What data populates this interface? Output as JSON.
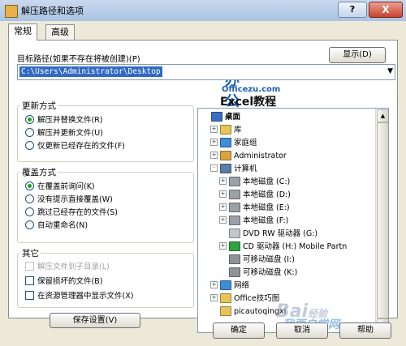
{
  "window": {
    "title": "解压路径和选项",
    "help_label": "?",
    "close_label": "X"
  },
  "tabs": [
    {
      "label": "常规"
    },
    {
      "label": "高级"
    }
  ],
  "logo": {
    "main": "办公族",
    "sub": "Officezu.com",
    "subtitle": "Excel教程"
  },
  "target": {
    "label": "目标路径(如果不存在将被创建)(P)",
    "value": "C:\\Users\\Administrator\\Desktop",
    "show_button": "显示(D)"
  },
  "update_mode": {
    "title": "更新方式",
    "options": [
      {
        "label": "解压并替换文件(R)",
        "selected": true
      },
      {
        "label": "解压并更新文件(U)",
        "selected": false
      },
      {
        "label": "仅更新已经存在的文件(F)",
        "selected": false
      }
    ]
  },
  "overwrite_mode": {
    "title": "覆盖方式",
    "options": [
      {
        "label": "在覆盖前询问(K)",
        "selected": true
      },
      {
        "label": "没有提示直接覆盖(W)",
        "selected": false
      },
      {
        "label": "跳过已经存在的文件(S)",
        "selected": false
      },
      {
        "label": "自动重命名(N)",
        "selected": false
      }
    ]
  },
  "misc": {
    "title": "其它",
    "options": [
      {
        "label": "解压文件到子目录(L)",
        "checked": false,
        "disabled": true
      },
      {
        "label": "保留损坏的文件(B)",
        "checked": false,
        "disabled": false
      },
      {
        "label": "在资源管理器中显示文件(X)",
        "checked": false,
        "disabled": false
      }
    ]
  },
  "save_button": "保存设置(V)",
  "tree": {
    "items": [
      {
        "label": "桌面",
        "level": 0,
        "expander": "",
        "icon": "desktop-icon",
        "color": "#3a6fc4",
        "bold": true
      },
      {
        "label": "库",
        "level": 1,
        "expander": "+",
        "icon": "folder-icon",
        "color": "#e7c45a"
      },
      {
        "label": "家庭组",
        "level": 1,
        "expander": "+",
        "icon": "homegroup-icon",
        "color": "#3d8ed8"
      },
      {
        "label": "Administrator",
        "level": 1,
        "expander": "+",
        "icon": "user-icon",
        "color": "#d8a53d"
      },
      {
        "label": "计算机",
        "level": 1,
        "expander": "-",
        "icon": "computer-icon",
        "color": "#5a7fa8"
      },
      {
        "label": "本地磁盘 (C:)",
        "level": 2,
        "expander": "+",
        "icon": "drive-icon",
        "color": "#9aa2a8"
      },
      {
        "label": "本地磁盘 (D:)",
        "level": 2,
        "expander": "+",
        "icon": "drive-icon",
        "color": "#9aa2a8"
      },
      {
        "label": "本地磁盘 (E:)",
        "level": 2,
        "expander": "+",
        "icon": "drive-icon",
        "color": "#9aa2a8"
      },
      {
        "label": "本地磁盘 (F:)",
        "level": 2,
        "expander": "+",
        "icon": "drive-icon",
        "color": "#9aa2a8"
      },
      {
        "label": "DVD RW 驱动器 (G:)",
        "level": 2,
        "expander": "",
        "icon": "dvd-icon",
        "color": "#c2c6ca"
      },
      {
        "label": "CD 驱动器 (H:) Mobile Partn",
        "level": 2,
        "expander": "+",
        "icon": "cd-icon",
        "color": "#2ea33f"
      },
      {
        "label": "可移动磁盘 (I:)",
        "level": 2,
        "expander": "",
        "icon": "removable-drive-icon",
        "color": "#8e9499"
      },
      {
        "label": "可移动磁盘 (K:)",
        "level": 2,
        "expander": "",
        "icon": "removable-drive-icon",
        "color": "#8e9499"
      },
      {
        "label": "网络",
        "level": 1,
        "expander": "+",
        "icon": "network-icon",
        "color": "#3d8ed8"
      },
      {
        "label": "Office技巧图",
        "level": 1,
        "expander": "+",
        "icon": "folder-icon",
        "color": "#e7c45a"
      },
      {
        "label": "picautoqingxi",
        "level": 1,
        "expander": "",
        "icon": "folder-icon",
        "color": "#e7c45a"
      }
    ]
  },
  "watermark": {
    "text": "Bai",
    "sub": "经验",
    "caption": "我要自学网"
  },
  "footer": {
    "ok": "确定",
    "cancel": "取消",
    "help": "帮助"
  },
  "colors": {
    "selection": "#316ac5",
    "radio_dot": "#21a121",
    "title_bar": "#a9c3e4"
  }
}
